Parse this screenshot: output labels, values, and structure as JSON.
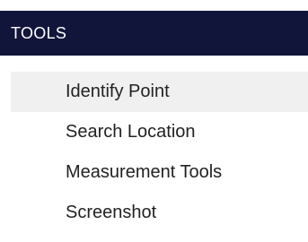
{
  "header": {
    "title": "TOOLS"
  },
  "menu": {
    "items": [
      {
        "label": "Identify Point"
      },
      {
        "label": "Search Location"
      },
      {
        "label": "Measurement Tools"
      },
      {
        "label": "Screenshot"
      }
    ]
  },
  "colors": {
    "header_bg": "#12153a",
    "header_text": "#ffffff",
    "active_item_bg": "#f0f0f0",
    "item_text": "#222222"
  }
}
